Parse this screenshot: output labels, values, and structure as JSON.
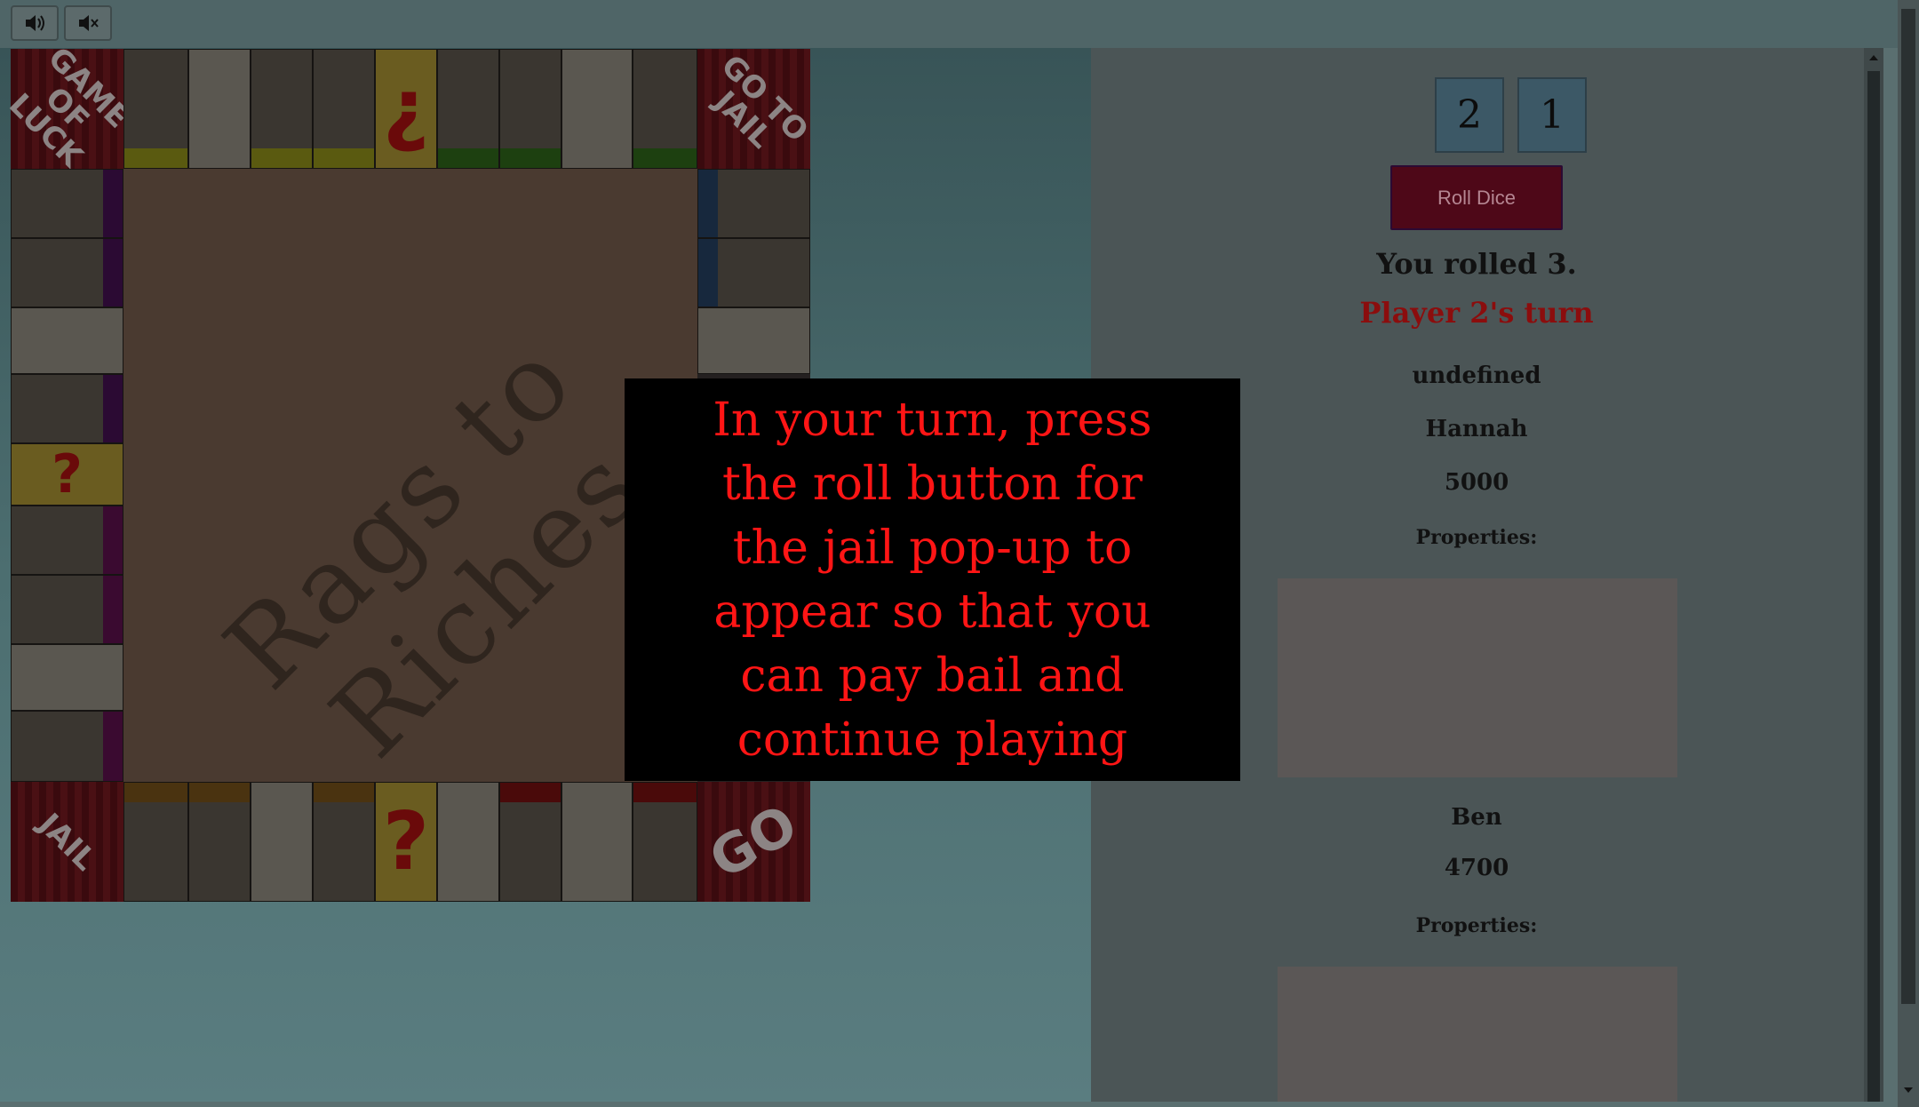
{
  "audio": {
    "unmute_icon": "speaker-on-icon",
    "mute_icon": "speaker-mute-icon"
  },
  "board": {
    "title": "Rags to Riches",
    "corners": {
      "top_left": "GAME OF LUCK",
      "top_right": "GO TO JAIL",
      "bottom_left": "JAIL",
      "bottom_right": "GO"
    },
    "question_mark": "?",
    "inverted_question_mark": "¿"
  },
  "dice": {
    "die1": "2",
    "die2": "1"
  },
  "controls": {
    "roll_label": "Roll Dice"
  },
  "status": {
    "rolled": "You rolled 3.",
    "turn": "Player 2's turn",
    "message": "undefined"
  },
  "players": [
    {
      "name": "Hannah",
      "money": "5000",
      "properties_label": "Properties:"
    },
    {
      "name": "Ben",
      "money": "4700",
      "properties_label": "Properties:"
    }
  ],
  "modal": {
    "text": "In your turn, press the roll button for the jail pop-up to appear so that you can pay bail and continue playing"
  },
  "colors": {
    "modal_text": "#ff1515",
    "turn_text": "#8b0d0d",
    "roll_button": "#4e0818"
  }
}
